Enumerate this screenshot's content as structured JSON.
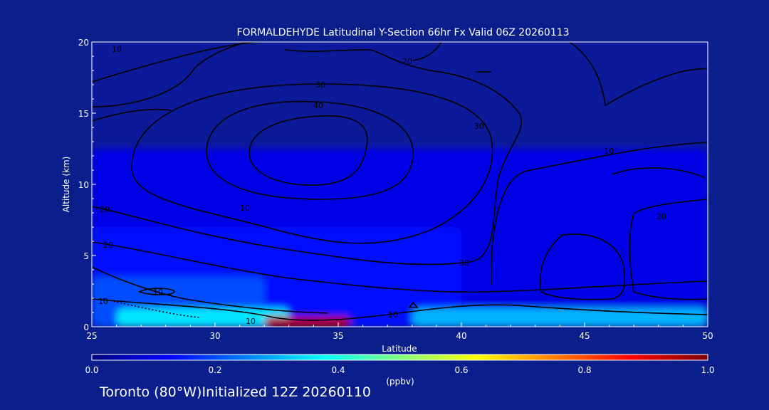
{
  "chart_data": {
    "type": "heatmap",
    "title": "FORMALDEHYDE Latitudinal Y-Section 66hr  Fx Valid 06Z 20260113",
    "xlabel": "Latitude",
    "ylabel": "Altitude (km)",
    "xlim": [
      25,
      50
    ],
    "ylim": [
      0,
      20
    ],
    "x_ticks": [
      "25",
      "30",
      "35",
      "40",
      "45",
      "50"
    ],
    "y_ticks": [
      "0",
      "5",
      "10",
      "15",
      "20"
    ],
    "colorbar": {
      "label": "(ppbv)",
      "range": [
        0.0,
        1.0
      ],
      "ticks": [
        "0.0",
        "0.2",
        "0.4",
        "0.6",
        "0.8",
        "1.0"
      ],
      "colormap": "jet"
    },
    "concentration_regions": [
      {
        "lat": [
          25,
          50
        ],
        "alt": [
          0,
          12.5
        ],
        "value": 0.1
      },
      {
        "lat": [
          25,
          40
        ],
        "alt": [
          0,
          7
        ],
        "value": 0.14
      },
      {
        "lat": [
          25,
          32
        ],
        "alt": [
          0,
          3.5
        ],
        "value": 0.2
      },
      {
        "lat": [
          26,
          33
        ],
        "alt": [
          0,
          1.3
        ],
        "value": 0.35
      },
      {
        "lat": [
          38,
          50
        ],
        "alt": [
          0,
          1.3
        ],
        "value": 0.3
      },
      {
        "lat": [
          32,
          35.5
        ],
        "alt": [
          0,
          0.7
        ],
        "value": 0.95
      }
    ],
    "contour_labels": [
      "10",
      "20",
      "30",
      "40",
      "30",
      "20",
      "10",
      "20",
      "30",
      "20",
      "10",
      "10",
      "10",
      "10",
      "10"
    ]
  },
  "footer": "Toronto (80°W)Initialized 12Z 20260110",
  "colors": {
    "background": "#0a1e8c",
    "plot_background": "#0c1a9a",
    "contour": "#000000",
    "text": "#ffffff"
  }
}
